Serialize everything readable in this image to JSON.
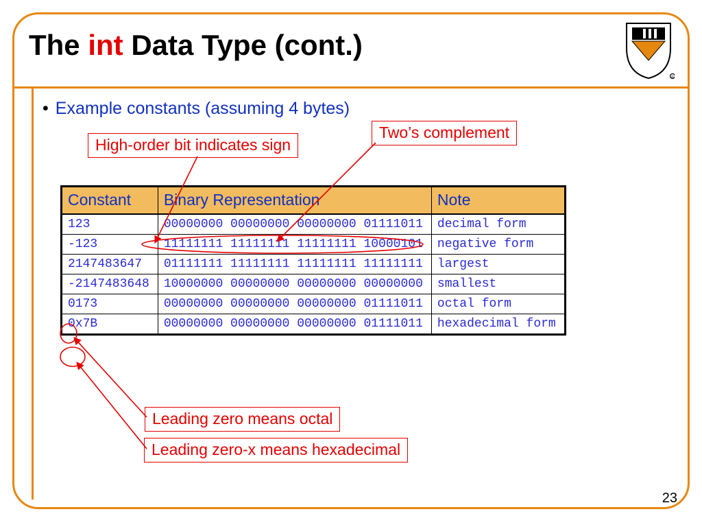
{
  "title": {
    "pre": "The ",
    "keyword": "int",
    "post": " Data Type (cont.)"
  },
  "bullet_text": "Example constants (assuming 4 bytes)",
  "annotations": {
    "high_order": "High-order bit indicates sign",
    "twos_complement": "Two’s complement",
    "leading_zero_octal": "Leading zero means octal",
    "leading_zero_hex": "Leading zero-x means hexadecimal"
  },
  "table": {
    "headers": {
      "c0": "Constant",
      "c1": "Binary Representation",
      "c2": "Note"
    },
    "rows": [
      {
        "constant": "123",
        "binary": "00000000 00000000 00000000 01111011",
        "note": "decimal form"
      },
      {
        "constant": "-123",
        "binary": "11111111 11111111 11111111 10000101",
        "note": "negative form"
      },
      {
        "constant": "2147483647",
        "binary": "01111111 11111111 11111111 11111111",
        "note": "largest"
      },
      {
        "constant": "-2147483648",
        "binary": "10000000 00000000 00000000 00000000",
        "note": "smallest"
      },
      {
        "constant": "0173",
        "binary": "00000000 00000000 00000000 01111011",
        "note": "octal form"
      },
      {
        "constant": "0x7B",
        "binary": "00000000 00000000 00000000 01111011",
        "note": "hexadecimal form"
      }
    ]
  },
  "page_number": "23"
}
